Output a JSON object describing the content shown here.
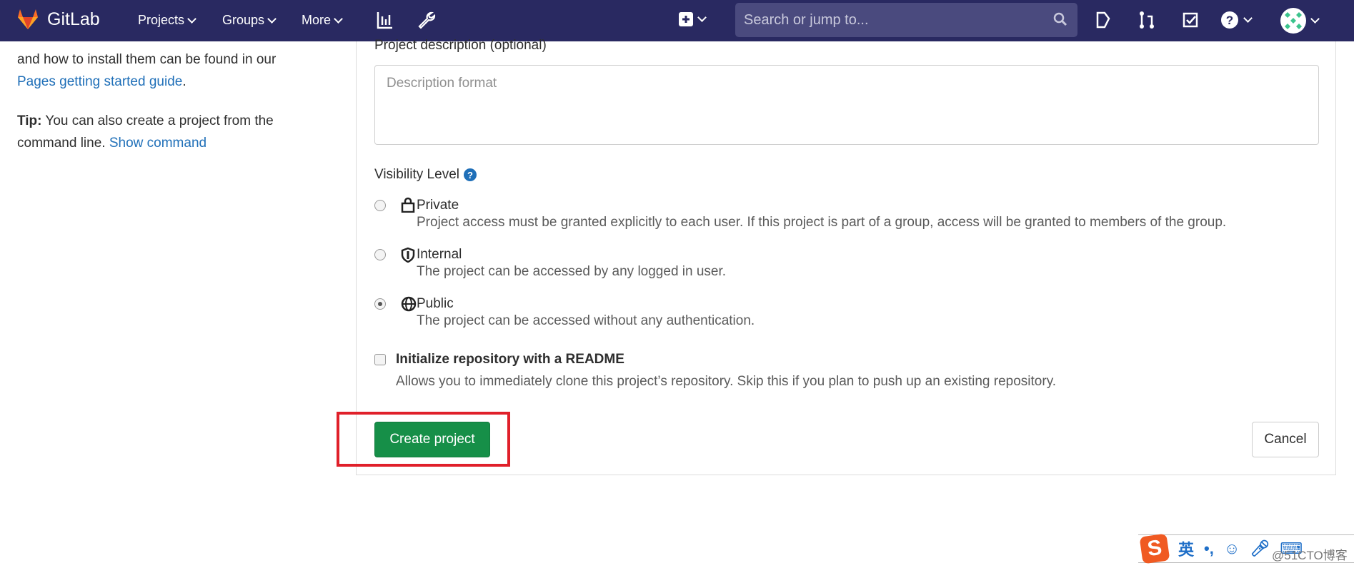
{
  "nav": {
    "brand": "GitLab",
    "projects": "Projects",
    "groups": "Groups",
    "more": "More",
    "search_placeholder": "Search or jump to...",
    "accent": "#292961"
  },
  "sidebar": {
    "text1": "and how to install them can be found in our",
    "link1": "Pages getting started guide",
    "period": ".",
    "tip_label": "Tip:",
    "tip_text": " You can also create a project from the command line. ",
    "tip_link": "Show command"
  },
  "form": {
    "description_label": "Project description (optional)",
    "description_placeholder": "Description format",
    "visibility_label": "Visibility Level",
    "options": [
      {
        "label": "Private",
        "desc": "Project access must be granted explicitly to each user. If this project is part of a group, access will be granted to members of the group.",
        "selected": false,
        "icon": "lock-icon"
      },
      {
        "label": "Internal",
        "desc": "The project can be accessed by any logged in user.",
        "selected": false,
        "icon": "shield-icon"
      },
      {
        "label": "Public",
        "desc": "The project can be accessed without any authentication.",
        "selected": true,
        "icon": "globe-icon"
      }
    ],
    "readme_label": "Initialize repository with a README",
    "readme_desc": "Allows you to immediately clone this project’s repository. Skip this if you plan to push up an existing repository.",
    "readme_checked": false,
    "create_button": "Create project",
    "cancel_button": "Cancel",
    "create_color": "#168f48",
    "highlight_color": "#e0202a"
  },
  "ime": {
    "lang": "英",
    "punct": "•,",
    "watermark": "@51CTO博客"
  }
}
